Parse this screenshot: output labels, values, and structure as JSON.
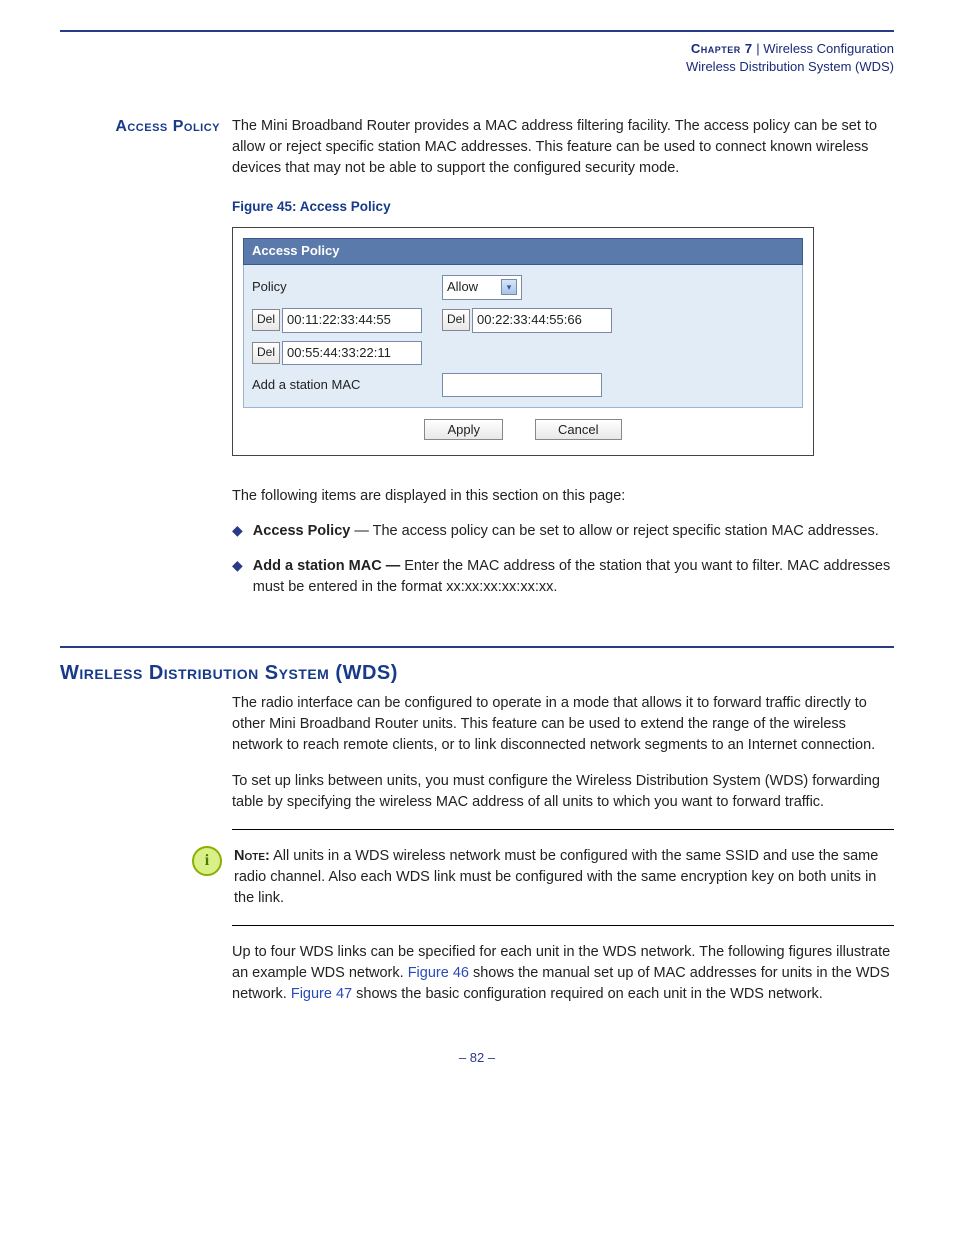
{
  "header": {
    "chapter": "Chapter 7",
    "title": "Wireless Configuration",
    "subtitle": "Wireless Distribution System (WDS)"
  },
  "section1": {
    "side_label": "Access Policy",
    "intro": "The Mini Broadband Router provides a MAC address filtering facility. The access policy can be set to allow or reject specific station MAC addresses. This feature can be used to connect known wireless devices that may not be able to support the configured security mode.",
    "figure_caption": "Figure 45:  Access Policy",
    "panel": {
      "title": "Access Policy",
      "policy_label": "Policy",
      "policy_value": "Allow",
      "del_label": "Del",
      "mac1": "00:11:22:33:44:55",
      "mac2": "00:22:33:44:55:66",
      "mac3": "00:55:44:33:22:11",
      "add_label": "Add a station MAC",
      "apply": "Apply",
      "cancel": "Cancel"
    },
    "after_figure": "The following items are displayed in this section on this page:",
    "bullets": [
      {
        "term": "Access Policy",
        "text": " — The access policy can be set to allow or reject specific station MAC addresses."
      },
      {
        "term": "Add a station MAC — ",
        "text": "Enter the MAC address of the station that you want to filter. MAC addresses must be entered in the format xx:xx:xx:xx:xx:xx."
      }
    ]
  },
  "section2": {
    "title": "Wireless Distribution System (WDS)",
    "p1": "The radio interface can be configured to operate in a mode that allows it to forward traffic directly to other Mini Broadband Router units. This feature can be used to extend the range of the wireless network to reach remote clients, or to link disconnected network segments to an Internet connection.",
    "p2": "To set up links between units, you must configure the Wireless Distribution System (WDS) forwarding table by specifying the wireless MAC address of all units to which you want to forward traffic.",
    "note_label": "Note:",
    "note_text": " All units in a WDS wireless network must be configured with the same SSID and use the same radio channel. Also each WDS link must be configured with the same encryption key on both units in the link.",
    "p3_a": "Up to four WDS links can be specified for each unit in the WDS network. The following figures illustrate an example WDS network. ",
    "fig46": "Figure 46",
    "p3_b": " shows the manual set up of MAC addresses for units in the WDS network. ",
    "fig47": "Figure 47",
    "p3_c": " shows the basic configuration required on each unit in the WDS network."
  },
  "page_number": "–  82  –"
}
